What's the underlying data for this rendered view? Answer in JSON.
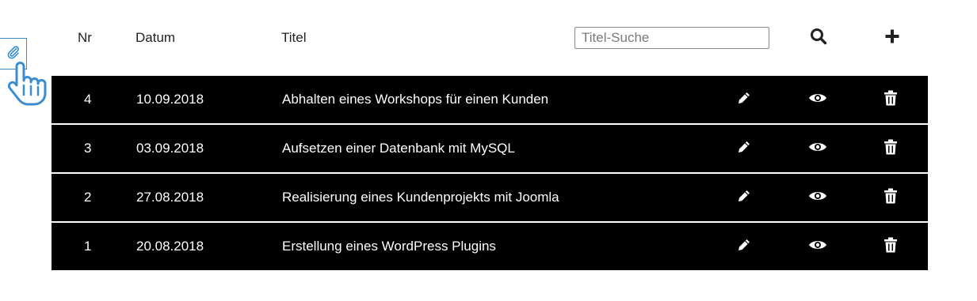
{
  "header": {
    "col_nr": "Nr",
    "col_datum": "Datum",
    "col_titel": "Titel"
  },
  "search": {
    "placeholder": "Titel-Suche",
    "value": ""
  },
  "icons": {
    "search": "search-icon",
    "add": "plus-icon",
    "attach": "paperclip-icon",
    "cursor": "hand-pointer-icon",
    "edit": "pencil-icon",
    "view": "eye-icon",
    "delete": "trash-icon"
  },
  "colors": {
    "row_background": "#000000",
    "row_text": "#ffffff",
    "accent": "#3a8dd0"
  },
  "rows": [
    {
      "nr": "4",
      "datum": "10.09.2018",
      "titel": "Abhalten eines Workshops für einen Kunden"
    },
    {
      "nr": "3",
      "datum": "03.09.2018",
      "titel": "Aufsetzen einer Datenbank mit MySQL"
    },
    {
      "nr": "2",
      "datum": "27.08.2018",
      "titel": "Realisierung eines Kundenprojekts mit Joomla"
    },
    {
      "nr": "1",
      "datum": "20.08.2018",
      "titel": "Erstellung eines WordPress Plugins"
    }
  ]
}
